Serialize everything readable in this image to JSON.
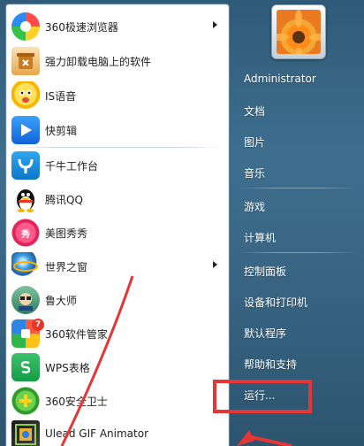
{
  "programs": [
    {
      "label": "360极速浏览器",
      "icon": "360-browser-icon",
      "has_submenu": true
    },
    {
      "label": "强力卸载电脑上的软件",
      "icon": "uninstall-icon",
      "has_submenu": false
    },
    {
      "label": "IS语音",
      "icon": "is-voice-icon",
      "has_submenu": false
    },
    {
      "label": "快剪辑",
      "icon": "video-editor-icon",
      "has_submenu": false
    },
    {
      "label": "千牛工作台",
      "icon": "qianniu-icon",
      "has_submenu": false
    },
    {
      "label": "腾讯QQ",
      "icon": "qq-penguin-icon",
      "has_submenu": false
    },
    {
      "label": "美图秀秀",
      "icon": "meitu-icon",
      "has_submenu": false
    },
    {
      "label": "世界之窗",
      "icon": "theworld-browser-icon",
      "has_submenu": true
    },
    {
      "label": "鲁大师",
      "icon": "ludashi-icon",
      "has_submenu": false
    },
    {
      "label": "360软件管家",
      "icon": "360-software-manager-icon",
      "has_submenu": false,
      "badge": "7"
    },
    {
      "label": "WPS表格",
      "icon": "wps-spreadsheet-icon",
      "has_submenu": false
    },
    {
      "label": "360安全卫士",
      "icon": "360-security-icon",
      "has_submenu": false
    },
    {
      "label": "Ulead GIF Animator",
      "icon": "gif-animator-icon",
      "has_submenu": false
    }
  ],
  "right_menu": {
    "user": "Administrator",
    "items": [
      "文档",
      "图片",
      "音乐",
      "游戏",
      "计算机",
      "控制面板",
      "设备和打印机",
      "默认程序",
      "帮助和支持",
      "运行..."
    ]
  },
  "highlight_color": "#e53535"
}
